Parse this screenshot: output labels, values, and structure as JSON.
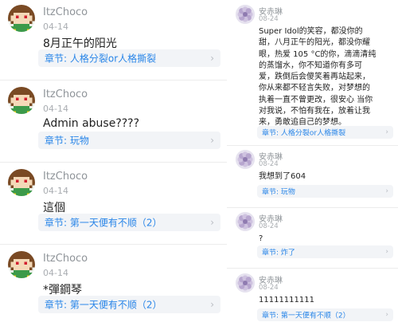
{
  "left_comments": [
    {
      "user": "ItzChoco",
      "date": "04-14",
      "text": "8月正午的阳光",
      "chapter_prefix": "章节:",
      "chapter": "人格分裂or人格撕裂"
    },
    {
      "user": "ItzChoco",
      "date": "04-14",
      "text": "Admin abuse????",
      "chapter_prefix": "章节:",
      "chapter": "玩物"
    },
    {
      "user": "ItzChoco",
      "date": "04-14",
      "text": "這個",
      "chapter_prefix": "章节:",
      "chapter": "第一天便有不顺（2）"
    },
    {
      "user": "ItzChoco",
      "date": "04-14",
      "text": "*彈鋼琴",
      "chapter_prefix": "章节:",
      "chapter": "第一天便有不顺（2）"
    }
  ],
  "right_comments": [
    {
      "user": "安赤琳",
      "date": "08-24",
      "text": "Super Idol的笑容，都没你的\n甜，八月正午的阳光，都没你耀\n眼，热爱 105 °C的你，滴滴清纯\n的蒸馏水，你不知道你有多可\n爱，跌倒后会傻笑着再站起来，\n你从来都不轻言失败，对梦想的\n执着一直不曾更改，很安心 当你\n对我说，不怕有我在，放着让我\n来，勇敢追自己的梦想。",
      "chapter_prefix": "章节:",
      "chapter": "人格分裂or人格撕裂"
    },
    {
      "user": "安赤琳",
      "date": "08-24",
      "text": "我想到了604",
      "chapter_prefix": "章节:",
      "chapter": "玩物"
    },
    {
      "user": "安赤琳",
      "date": "08-24",
      "text": "?",
      "chapter_prefix": "章节:",
      "chapter": "炸了"
    },
    {
      "user": "安赤琳",
      "date": "08-24",
      "text": "11111111111",
      "chapter_prefix": "章节:",
      "chapter": "第一天便有不顺（2）"
    }
  ],
  "icons": {
    "avatar_left": "chara-pixel-avatar",
    "avatar_right": "flower-avatar",
    "chevron": "chevron-right-icon"
  },
  "colors": {
    "accent": "#2a86e8",
    "chip_bg": "#f2f4f7"
  }
}
